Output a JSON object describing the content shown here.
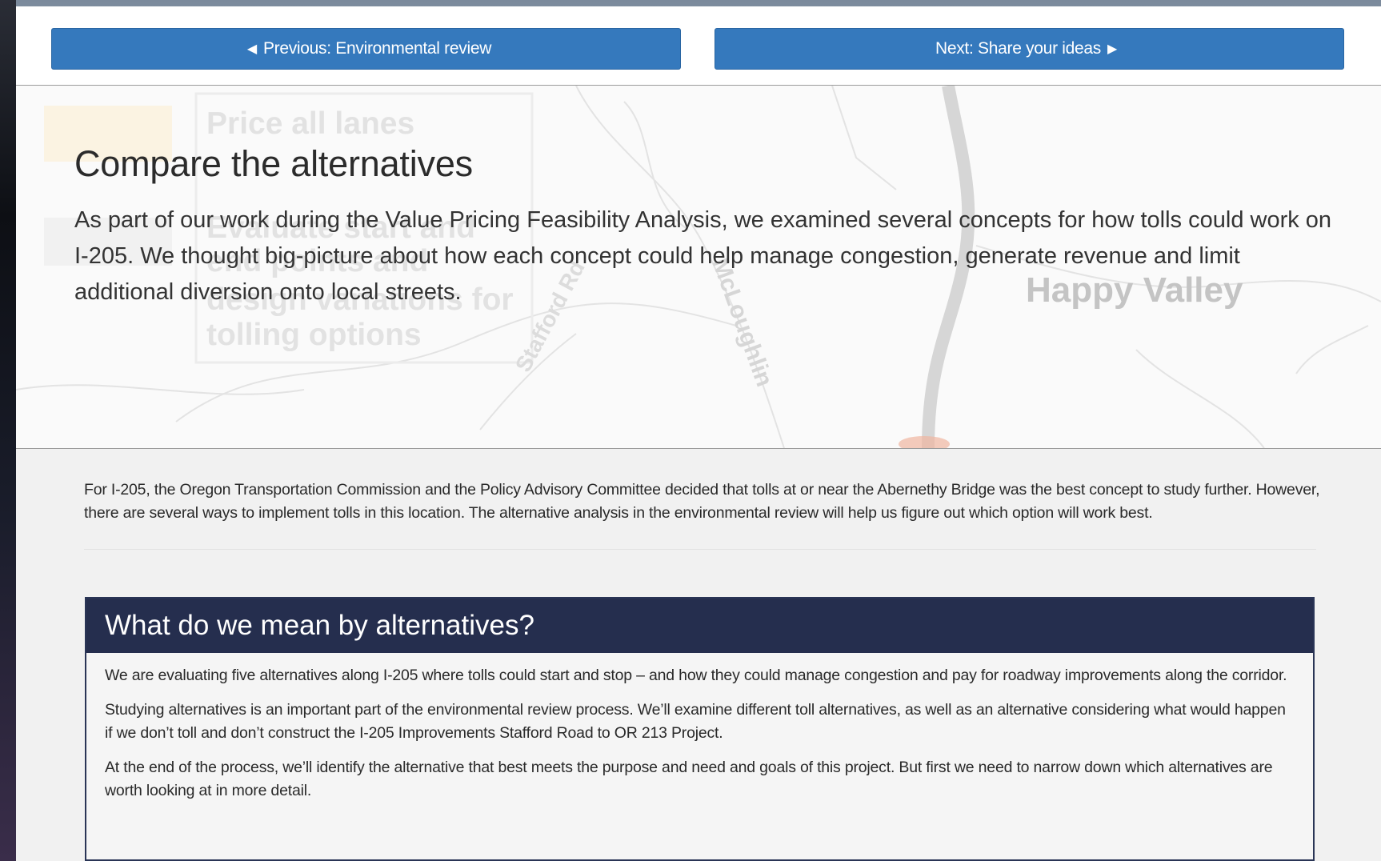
{
  "nav": {
    "prev_label": "Previous: Environmental review",
    "next_label": "Next: Share your ideas"
  },
  "hero": {
    "title": "Compare the alternatives",
    "intro": "As part of our work during the Value Pricing Feasibility Analysis, we examined several concepts for how tolls could work on I-205. We thought big-picture about how each concept could help manage congestion, generate revenue and limit additional diversion onto local streets.",
    "background_map": {
      "panel_lines": [
        "Price all lanes",
        "Evaluate start and",
        "end points and",
        "design variations for",
        "tolling options"
      ],
      "place_label": "Happy Valley",
      "road_labels": [
        "Stafford Rd",
        "McLoughlin"
      ]
    }
  },
  "body": {
    "paragraph": "For I-205, the Oregon Transportation Commission and the Policy Advisory Committee decided that tolls at or near the Abernethy Bridge was the best concept to study further. However, there are several ways to implement tolls in this location. The alternative analysis in the environmental review will help us figure out which option will work best."
  },
  "alternatives_box": {
    "title": "What do we mean by alternatives?",
    "paragraphs": [
      "We are evaluating five alternatives along I-205 where tolls could start and stop – and how they could manage congestion and pay for roadway improvements along the corridor.",
      "Studying alternatives is an important part of the environmental review process. We’ll examine different toll alternatives, as well as an alternative considering what would happen if we don’t toll and don’t construct the I-205 Improvements Stafford Road to OR 213 Project.",
      "At the end of the process, we’ll identify the alternative that best meets the purpose and need and goals of this project. But first we need to narrow down which alternatives are worth looking at in more detail."
    ]
  },
  "colors": {
    "button_blue": "#3579bd",
    "box_header_navy": "#252e4e"
  }
}
